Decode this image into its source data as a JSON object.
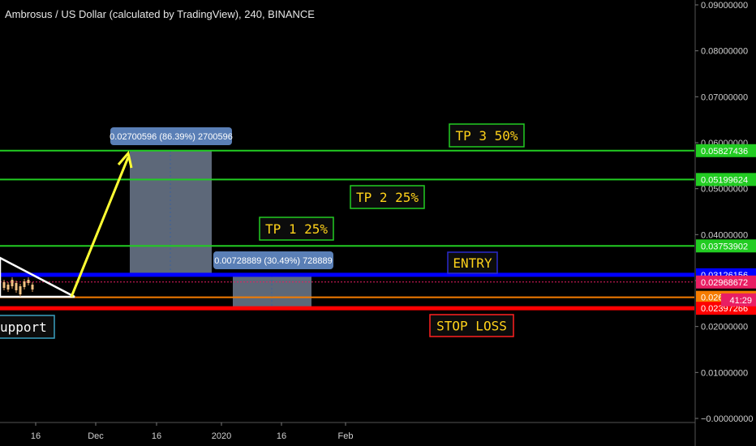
{
  "header": {
    "title": "Ambrosus / US Dollar (calculated by TradingView), 240, BINANCE"
  },
  "chart_data": {
    "type": "line",
    "title": "Ambrosus / US Dollar (calculated by TradingView), 240, BINANCE",
    "y_axis": {
      "ticks": [
        "0.09000000",
        "0.08000000",
        "0.07000000",
        "0.06000000",
        "0.05000000",
        "0.04000000",
        "0.03000000",
        "0.02000000",
        "0.01000000",
        "−0.00000000"
      ],
      "ylim": [
        0,
        0.09
      ]
    },
    "x_axis": {
      "ticks": [
        "16",
        "Dec",
        "16",
        "2020",
        "16",
        "Feb"
      ]
    },
    "levels": [
      {
        "label": "TP 3 50%",
        "price": "0.05827436",
        "color": "#22cc22"
      },
      {
        "label": "TP 2 25%",
        "price": "0.05199624",
        "color": "#22cc22"
      },
      {
        "label": "TP 1 25%",
        "price": "0.03753902",
        "color": "#22cc22"
      },
      {
        "label": "ENTRY",
        "price": "0.03126156",
        "color": "#0000ff"
      },
      {
        "label": "",
        "price": "0.02968672",
        "color": "#e91e63"
      },
      {
        "label": "",
        "price": "0.02635042",
        "color": "#f57c00"
      },
      {
        "label": "STOP LOSS",
        "price": "0.02397266",
        "color": "#ff0000"
      }
    ],
    "countdown": "41:29",
    "measurements": [
      {
        "text": "0.02700596 (86.39%) 2700596"
      },
      {
        "text": "0.00728889 (30.49%) 728889"
      }
    ],
    "annotations": [
      "upport"
    ]
  }
}
